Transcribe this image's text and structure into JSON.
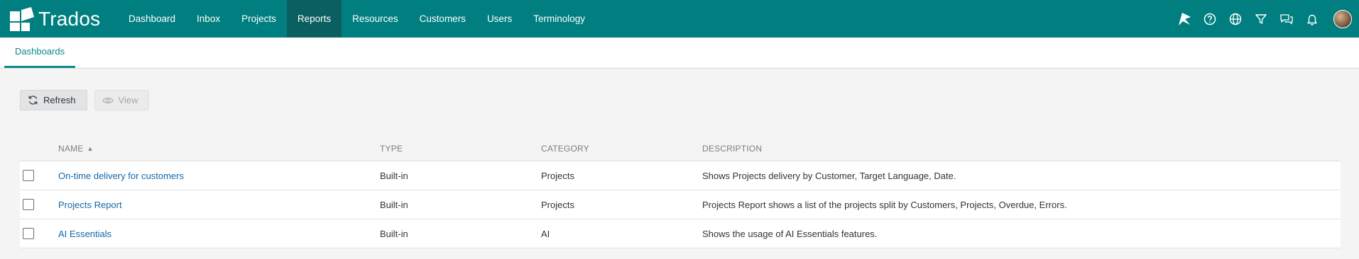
{
  "app": {
    "name": "Trados"
  },
  "nav": [
    {
      "label": "Dashboard",
      "active": false
    },
    {
      "label": "Inbox",
      "active": false
    },
    {
      "label": "Projects",
      "active": false
    },
    {
      "label": "Reports",
      "active": true
    },
    {
      "label": "Resources",
      "active": false
    },
    {
      "label": "Customers",
      "active": false
    },
    {
      "label": "Users",
      "active": false
    },
    {
      "label": "Terminology",
      "active": false
    }
  ],
  "top_icons": [
    "launch-icon",
    "help-icon",
    "globe-icon",
    "filter-icon",
    "chat-icon",
    "bell-icon",
    "avatar"
  ],
  "subtabs": [
    {
      "label": "Dashboards",
      "active": true
    }
  ],
  "toolbar": {
    "refresh_label": "Refresh",
    "view_label": "View"
  },
  "table": {
    "headers": {
      "name": "NAME",
      "type": "TYPE",
      "category": "CATEGORY",
      "description": "DESCRIPTION"
    },
    "sort": {
      "column": "name",
      "direction": "ascending"
    },
    "rows": [
      {
        "name": "On-time delivery for customers",
        "type": "Built-in",
        "category": "Projects",
        "description": "Shows Projects delivery by Customer, Target Language, Date."
      },
      {
        "name": "Projects Report",
        "type": "Built-in",
        "category": "Projects",
        "description": "Projects Report shows a list of the projects split by Customers, Projects, Overdue, Errors."
      },
      {
        "name": "AI Essentials",
        "type": "Built-in",
        "category": "AI",
        "description": "Shows the usage of AI Essentials features."
      }
    ]
  },
  "colors": {
    "header_bg": "#017f80",
    "active_nav_bg": "#0b5f60",
    "accent": "#0c8a8a",
    "link": "#1368a8"
  }
}
